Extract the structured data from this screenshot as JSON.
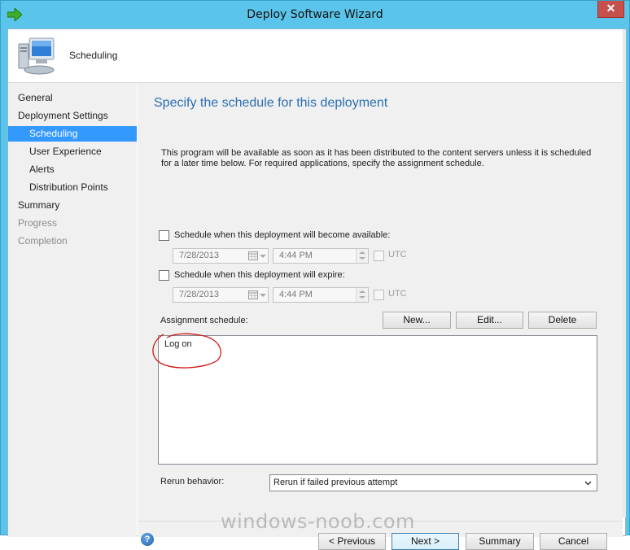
{
  "window": {
    "title": "Deploy Software Wizard",
    "close_label": "✕"
  },
  "header": {
    "title": "Scheduling"
  },
  "nav": {
    "items": [
      {
        "label": "General",
        "state": "normal"
      },
      {
        "label": "Deployment Settings",
        "state": "normal"
      },
      {
        "label": "Scheduling",
        "state": "selected"
      },
      {
        "label": "User Experience",
        "state": "normal"
      },
      {
        "label": "Alerts",
        "state": "normal"
      },
      {
        "label": "Distribution Points",
        "state": "normal"
      },
      {
        "label": "Summary",
        "state": "normal"
      },
      {
        "label": "Progress",
        "state": "disabled"
      },
      {
        "label": "Completion",
        "state": "disabled"
      }
    ]
  },
  "main": {
    "heading": "Specify the schedule for this deployment",
    "description": "This program will be available as soon as it has been distributed to the content servers unless it is scheduled for a later time below. For required applications, specify the assignment schedule.",
    "available": {
      "label": "Schedule when this deployment will become available:",
      "checked": false,
      "date": "7/28/2013",
      "time": "4:44 PM",
      "utc_label": "UTC"
    },
    "expire": {
      "label": "Schedule when this deployment will expire:",
      "checked": false,
      "date": "7/28/2013",
      "time": "4:44 PM",
      "utc_label": "UTC"
    },
    "assignment": {
      "label": "Assignment schedule:",
      "buttons": {
        "new": "New...",
        "edit": "Edit...",
        "delete": "Delete"
      },
      "items": [
        "Log on"
      ]
    },
    "rerun": {
      "label": "Rerun behavior:",
      "selected": "Rerun if failed previous attempt"
    }
  },
  "footer": {
    "previous": "< Previous",
    "next": "Next >",
    "summary": "Summary",
    "cancel": "Cancel"
  },
  "watermark": "windows-noob.com",
  "colors": {
    "title_bar": "#5bc4ea",
    "selected_nav": "#3399ff",
    "heading": "#2a6fb4",
    "annotation": "#d01818"
  }
}
